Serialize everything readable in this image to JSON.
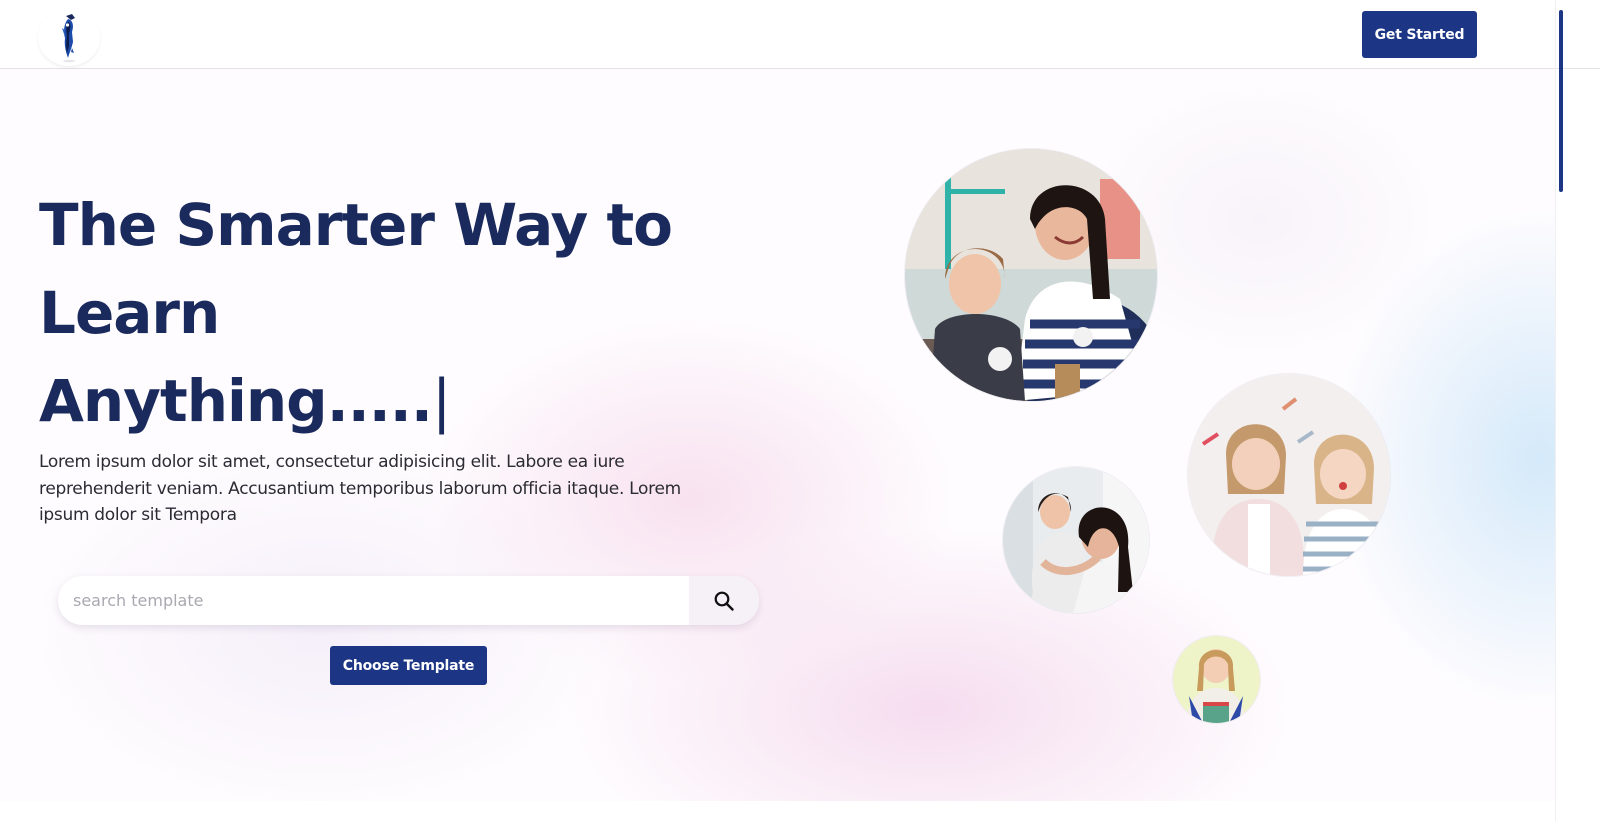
{
  "header": {
    "logo": "owl-mascot-logo",
    "get_started_label": "Get Started"
  },
  "hero": {
    "headline_line1": "The Smarter Way to",
    "headline_line2": "Learn",
    "headline_line3": "Anything.....",
    "caret": "|",
    "paragraph": "Lorem ipsum dolor sit amet, consectetur adipisicing elit. Labore ea iure reprehenderit veniam. Accusantium temporibus laborum officia itaque. Lorem ipsum dolor sit Tempora",
    "search": {
      "placeholder": "search template",
      "value": "",
      "button_icon": "search-icon"
    },
    "choose_template_label": "Choose Template"
  },
  "photos": [
    {
      "subject": "mother-and-daughter-painting"
    },
    {
      "subject": "two-girls-playing"
    },
    {
      "subject": "mother-carrying-daughter"
    },
    {
      "subject": "schoolgirl-with-backpack"
    }
  ],
  "colors": {
    "brand": "#1d3585",
    "headline": "#1a2a5c",
    "body_text": "#2b2b33"
  }
}
